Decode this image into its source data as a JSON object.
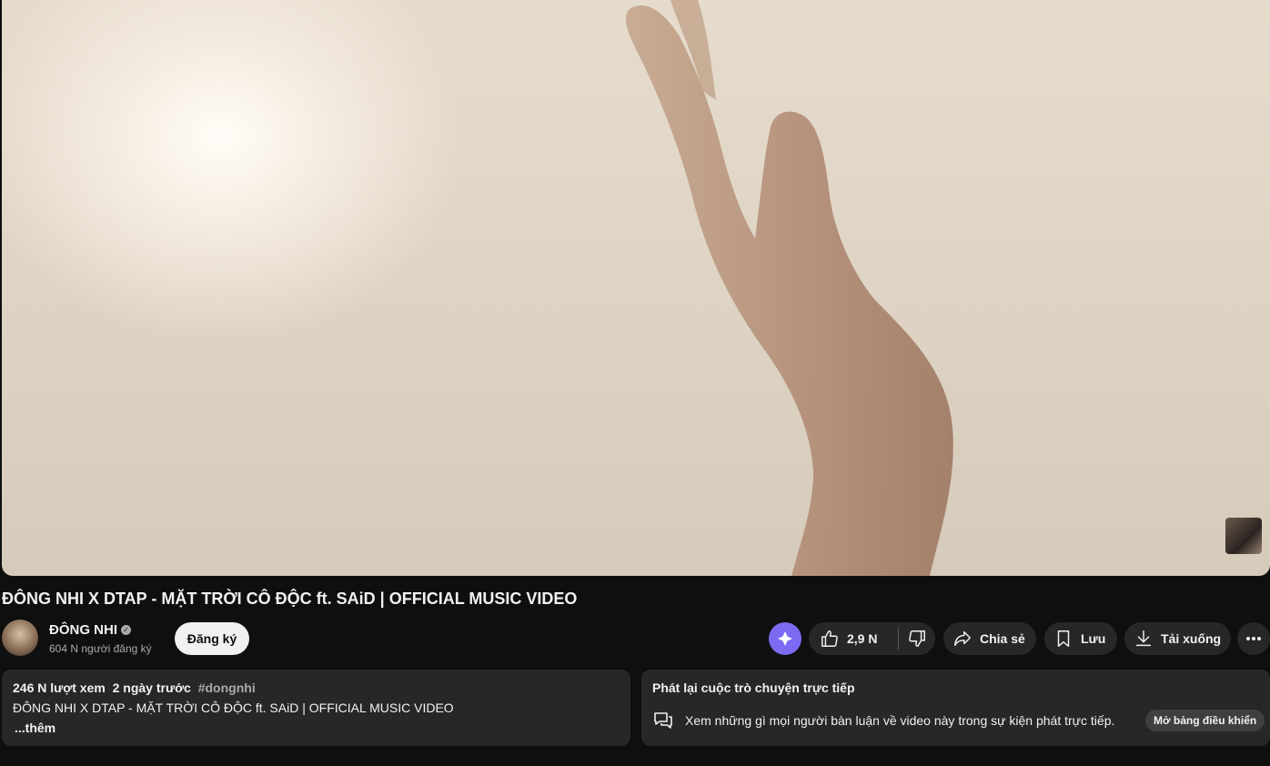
{
  "video": {
    "title": "ĐÔNG NHI X DTAP - MẶT TRỜI CÔ ĐỘC ft. SAiD | OFFICIAL MUSIC VIDEO"
  },
  "channel": {
    "name": "ĐÔNG NHI",
    "subscribers": "604 N người đăng ký",
    "subscribe_label": "Đăng ký"
  },
  "actions": {
    "like_count": "2,9 N",
    "share_label": "Chia sẻ",
    "save_label": "Lưu",
    "download_label": "Tải xuống"
  },
  "description": {
    "views": "246 N lượt xem",
    "time": "2 ngày trước",
    "hashtag": "#dongnhi",
    "text": "ĐÔNG NHI X DTAP - MẶT TRỜI CÔ ĐỘC ft. SAiD | OFFICIAL MUSIC VIDEO",
    "more": "...thêm"
  },
  "live_chat": {
    "heading": "Phát lại cuộc trò chuyện trực tiếp",
    "text": "Xem những gì mọi người bàn luận về video này trong sự kiện phát trực tiếp.",
    "open_label": "Mở bảng điều khiển"
  },
  "icons": {
    "ai": "sparkle-icon",
    "like": "thumbs-up-icon",
    "dislike": "thumbs-down-icon",
    "share": "share-arrow-icon",
    "save": "bookmark-icon",
    "download": "download-icon",
    "more": "more-horizontal-icon",
    "chat": "chat-bubbles-icon",
    "verified": "verified-check-icon"
  },
  "colors": {
    "background": "#0f0f0f",
    "surface": "#272727",
    "ai_accent": "#7b6af2",
    "text": "#f1f1f1",
    "muted": "#aaaaaa"
  }
}
